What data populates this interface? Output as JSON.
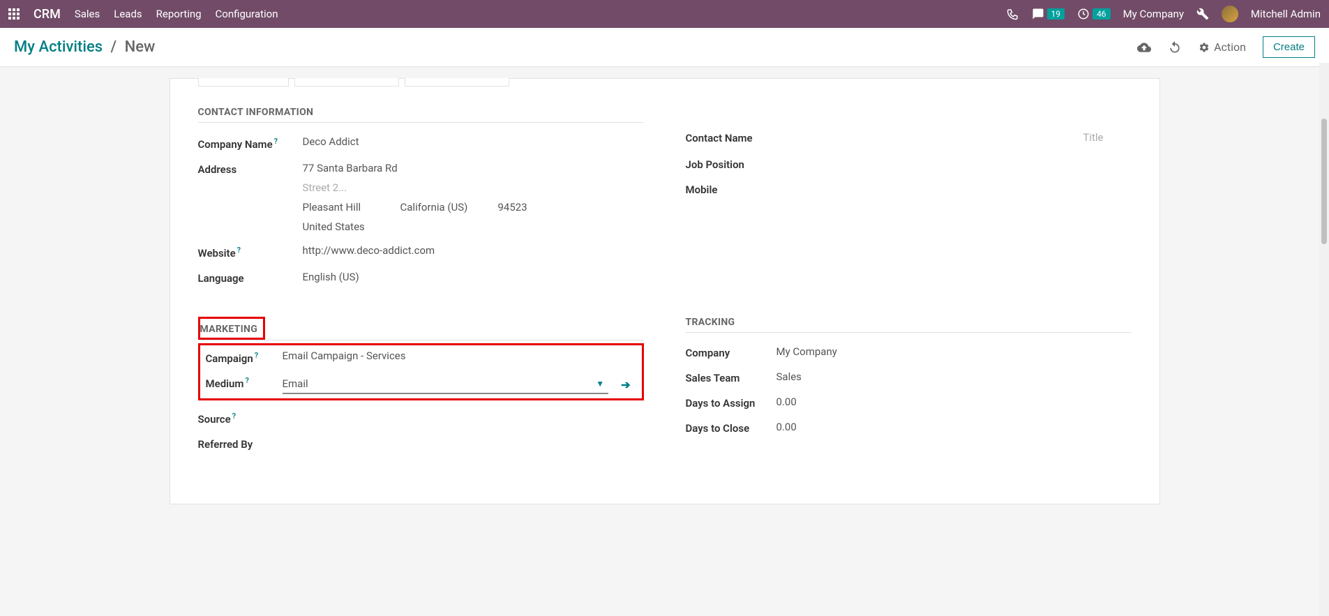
{
  "navbar": {
    "brand": "CRM",
    "links": [
      "Sales",
      "Leads",
      "Reporting",
      "Configuration"
    ],
    "messages_count": "19",
    "activities_count": "46",
    "company": "My Company",
    "user": "Mitchell Admin"
  },
  "breadcrumb": {
    "parent": "My Activities",
    "current": "New"
  },
  "controlbar": {
    "action_label": "Action",
    "create_label": "Create"
  },
  "sections": {
    "contact_info": "CONTACT INFORMATION",
    "marketing": "MARKETING",
    "tracking": "TRACKING"
  },
  "contact": {
    "company_name_label": "Company Name",
    "company_name_value": "Deco Addict",
    "address_label": "Address",
    "street1": "77 Santa Barbara Rd",
    "street2_placeholder": "Street 2...",
    "city": "Pleasant Hill",
    "state": "California (US)",
    "zip": "94523",
    "country": "United States",
    "website_label": "Website",
    "website_value": "http://www.deco-addict.com",
    "language_label": "Language",
    "language_value": "English (US)",
    "contact_name_label": "Contact Name",
    "title_placeholder": "Title",
    "job_position_label": "Job Position",
    "mobile_label": "Mobile"
  },
  "marketing": {
    "campaign_label": "Campaign",
    "campaign_value": "Email Campaign - Services",
    "medium_label": "Medium",
    "medium_value": "Email",
    "source_label": "Source",
    "referred_by_label": "Referred By"
  },
  "tracking": {
    "company_label": "Company",
    "company_value": "My Company",
    "sales_team_label": "Sales Team",
    "sales_team_value": "Sales",
    "days_assign_label": "Days to Assign",
    "days_assign_value": "0.00",
    "days_close_label": "Days to Close",
    "days_close_value": "0.00"
  }
}
